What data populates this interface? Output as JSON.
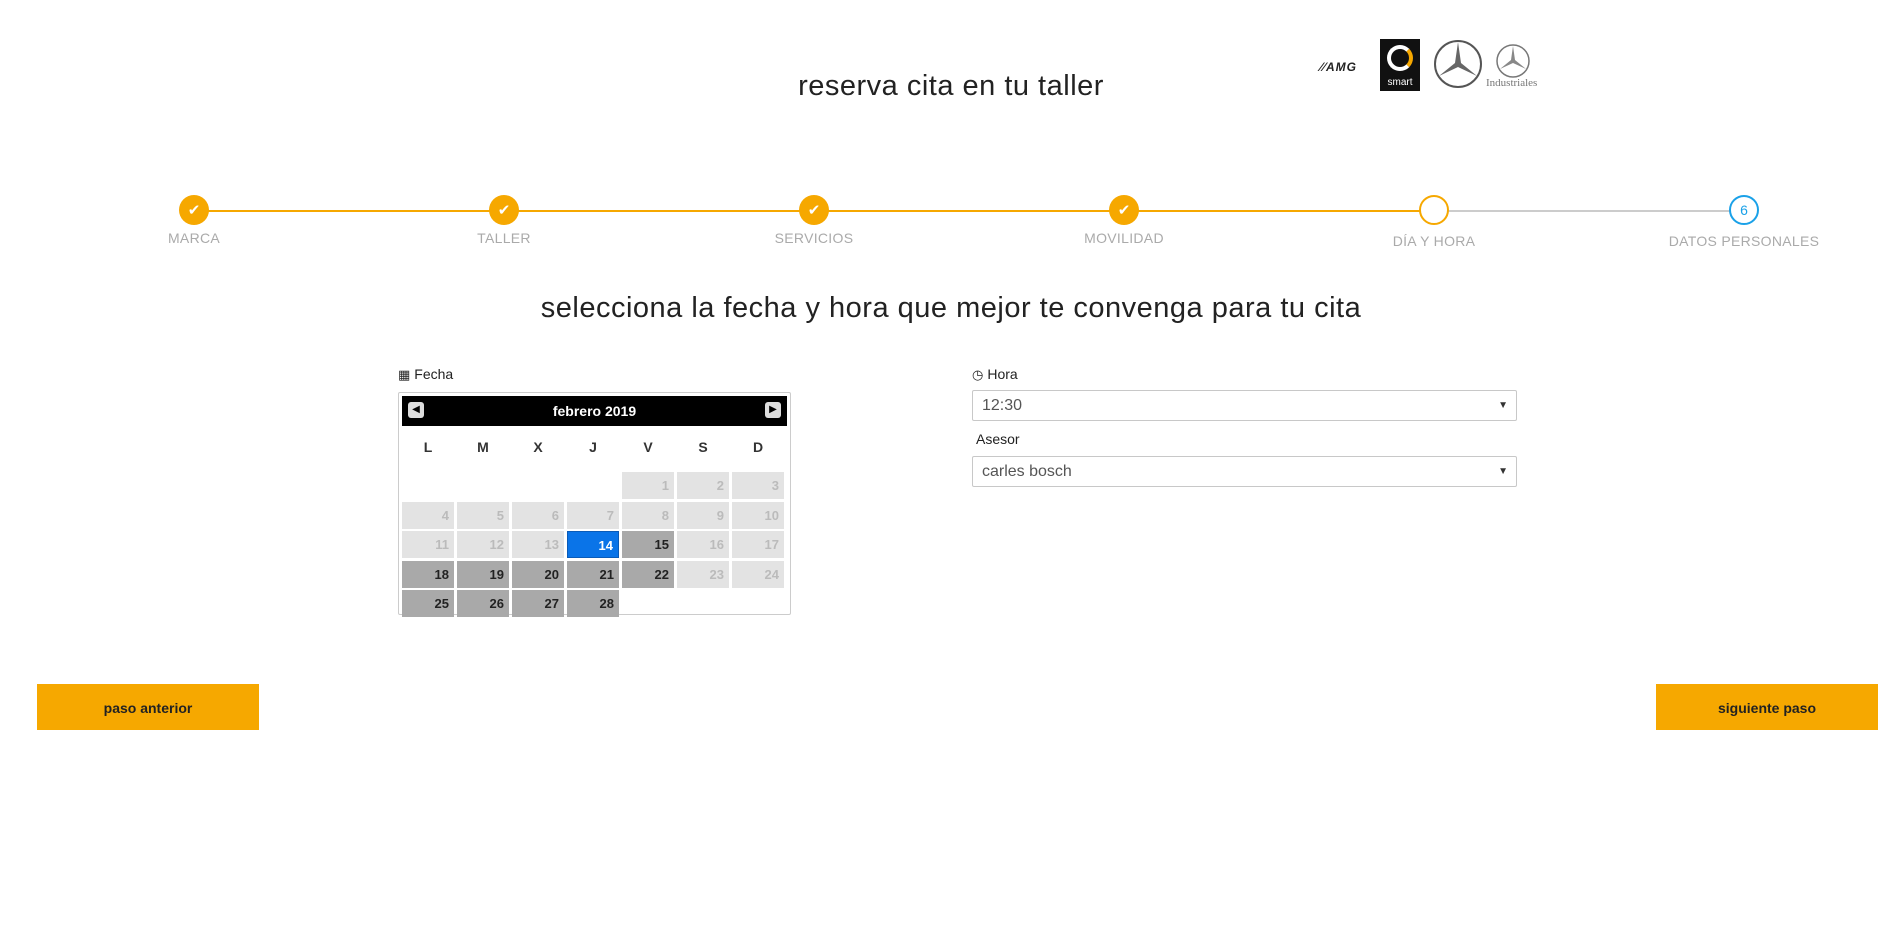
{
  "header": {
    "title": "reserva cita en tu taller",
    "brands": [
      {
        "name": "AMG",
        "icon": "amg-logo"
      },
      {
        "name": "smart",
        "icon": "smart-logo"
      },
      {
        "name": "Mercedes-Benz",
        "icon": "mercedes-star-logo"
      },
      {
        "name": "Industriales",
        "icon": "mercedes-star-small-logo"
      }
    ]
  },
  "colors": {
    "accent": "#f6a800",
    "future_step": "#1aa1e8",
    "selected_day": "#0a74e8",
    "available_day": "#a9a9a9",
    "disabled_day": "#e3e3e3"
  },
  "stepper": {
    "steps": [
      {
        "label": "MARCA",
        "state": "done",
        "icon": "check-icon"
      },
      {
        "label": "TALLER",
        "state": "done",
        "icon": "check-icon"
      },
      {
        "label": "SERVICIOS",
        "state": "done",
        "icon": "check-icon"
      },
      {
        "label": "MOVILIDAD",
        "state": "done",
        "icon": "check-icon"
      },
      {
        "label": "DÍA Y HORA",
        "state": "current",
        "icon": ""
      },
      {
        "label": "DATOS PERSONALES",
        "state": "future",
        "number": "6"
      }
    ]
  },
  "main": {
    "subtitle": "selecciona la fecha y hora que mejor te convenga para tu cita",
    "fecha_label": "Fecha",
    "hora_label": "Hora",
    "asesor_label": "Asesor",
    "hora_value": "12:30",
    "asesor_value": "carles bosch"
  },
  "calendar": {
    "month_label": "febrero 2019",
    "weekdays": [
      "L",
      "M",
      "X",
      "J",
      "V",
      "S",
      "D"
    ],
    "first_weekday_index": 4,
    "days_in_month": 28,
    "selected_day": 14,
    "available_days": [
      15,
      18,
      19,
      20,
      21,
      22,
      25,
      26,
      27,
      28
    ]
  },
  "buttons": {
    "prev_label": "paso anterior",
    "next_label": "siguiente paso"
  }
}
